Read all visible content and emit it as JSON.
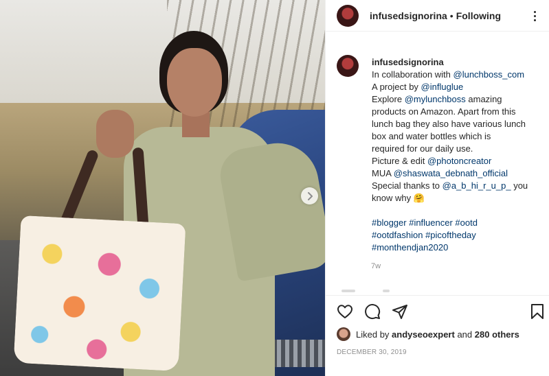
{
  "post": {
    "username": "infusedsignorina",
    "separator": "•",
    "follow_status": "Following"
  },
  "caption": {
    "username": "infusedsignorina",
    "lines": [
      {
        "pre": "In collaboration with ",
        "link": "@lunchboss_com",
        "post": ""
      },
      {
        "pre": "A project by ",
        "link": "@influglue",
        "post": ""
      },
      {
        "pre": "Explore ",
        "link": "@mylunchboss",
        "post": " amazing"
      },
      {
        "pre": "products on Amazon. Apart from this",
        "link": "",
        "post": ""
      },
      {
        "pre": "lunch bag they also have various lunch",
        "link": "",
        "post": ""
      },
      {
        "pre": "box and water bottles which is",
        "link": "",
        "post": ""
      },
      {
        "pre": "required for our daily use.",
        "link": "",
        "post": ""
      },
      {
        "pre": "Picture & edit ",
        "link": "@photoncreator",
        "post": ""
      },
      {
        "pre": "MUA ",
        "link": "@shaswata_debnath_official",
        "post": ""
      },
      {
        "pre": "Special thanks to ",
        "link": "@a_b_hi_r_u_p_",
        "post": " you"
      },
      {
        "pre": "know why 🤗",
        "link": "",
        "post": ""
      }
    ],
    "hashtags": [
      "#blogger #influencer #ootd",
      "#ootdfashion #picoftheday",
      "#monthendjan2020"
    ],
    "age": "7w"
  },
  "likes": {
    "prefix": "Liked by ",
    "user": "andyseoexpert",
    "middle": " and ",
    "others": "280 others"
  },
  "date": "DECEMBER 30, 2019",
  "icons": {
    "like": "heart-icon",
    "comment": "comment-icon",
    "share": "share-icon",
    "save": "bookmark-icon",
    "more": "more-options-icon",
    "next": "chevron-right-icon"
  },
  "colors": {
    "link": "#00376b",
    "text": "#262626",
    "muted": "#8e8e8e",
    "border": "#efefef"
  }
}
